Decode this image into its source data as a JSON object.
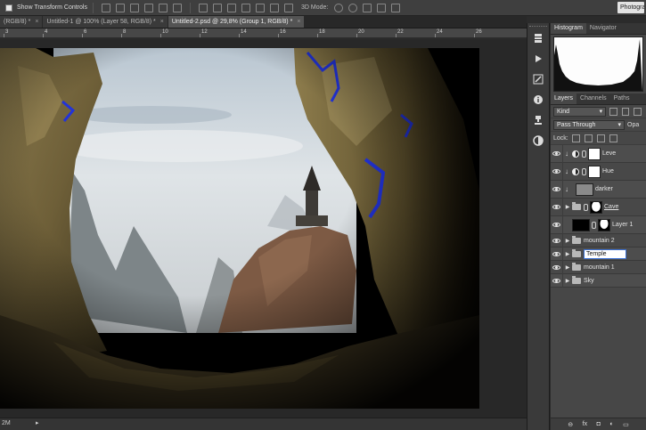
{
  "options_bar": {
    "show_transform_label": "Show Transform Controls",
    "mode_3d_label": "3D Mode:",
    "workspace_label": "Photography"
  },
  "tabs": [
    {
      "label": "(RGB/8) *",
      "close": "×"
    },
    {
      "label": "Untitled-1 @ 100% (Layer 58, RGB/8) *",
      "close": "×"
    },
    {
      "label": "Untitled-2.psd @ 29,8% (Group 1, RGB/8) *",
      "close": "×"
    }
  ],
  "ruler": [
    "3",
    "4",
    "6",
    "8",
    "10",
    "12",
    "14",
    "16",
    "18",
    "20",
    "22",
    "24",
    "26"
  ],
  "status": {
    "zoom": "2M",
    "arrow": "▸"
  },
  "strip_icons": [
    "layer-comps-icon",
    "play-icon",
    "brush-icon",
    "info-icon",
    "clone-source-icon",
    "color-wheel-icon"
  ],
  "panel_top": {
    "tabs": [
      "Histogram",
      "Navigator"
    ]
  },
  "layers_panel": {
    "tabs": [
      "Layers",
      "Channels",
      "Paths"
    ],
    "filter": "Kind",
    "blend": "Pass Through",
    "opacity_label": "Opa",
    "lock_label": "Lock:",
    "layers": [
      {
        "name": "Leve",
        "kind": "adjustment"
      },
      {
        "name": "Hue",
        "kind": "adjustment"
      },
      {
        "name": "darker",
        "kind": "pixel-clipped"
      },
      {
        "name": "Cave",
        "kind": "group-mask"
      },
      {
        "name": "Layer 1",
        "kind": "pixel-mask"
      },
      {
        "name": "mountain 2",
        "kind": "group"
      },
      {
        "name": "Temple",
        "kind": "group-renaming"
      },
      {
        "name": "mountain 1",
        "kind": "group"
      },
      {
        "name": "Sky",
        "kind": "group"
      }
    ],
    "footer": [
      "link-icon",
      "fx",
      "mask-icon",
      "adjustment-icon",
      "folder-icon"
    ]
  },
  "colors": {
    "panel_bg": "#474747",
    "app_bg": "#282828",
    "selection_blue": "#3a6fd1"
  }
}
